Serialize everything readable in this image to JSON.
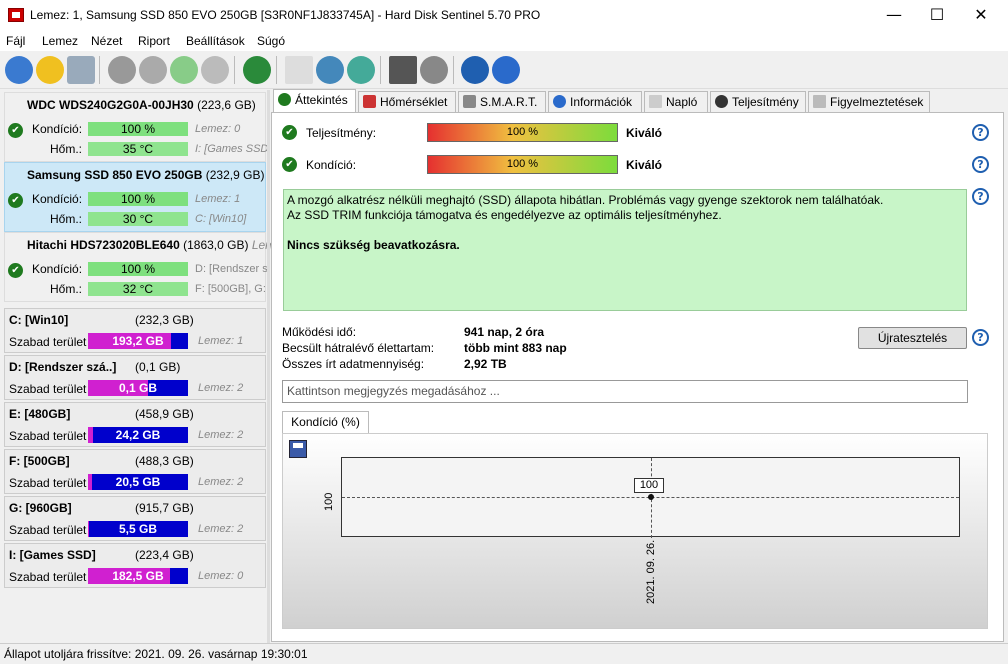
{
  "window": {
    "title": "Lemez: 1, Samsung SSD 850 EVO 250GB [S3R0NF1J833745A]  -  Hard Disk Sentinel 5.70 PRO",
    "minimize": "—",
    "maximize": "☐",
    "close": "✕"
  },
  "menu": [
    "Fájl",
    "Lemez",
    "Nézet",
    "Riport",
    "Beállítások",
    "Súgó"
  ],
  "disks": [
    {
      "name": "WDC WDS240G2G0A-00JH30",
      "size": "(223,6 GB)",
      "cond_label": "Kondíció:",
      "cond": "100 %",
      "temp_label": "Hőm.:",
      "temp": "35 °C",
      "side1": "Lemez: 0",
      "side2": "I: [Games SSD]"
    },
    {
      "name": "Samsung SSD 850 EVO 250GB",
      "size": "(232,9 GB)",
      "cond_label": "Kondíció:",
      "cond": "100 %",
      "temp_label": "Hőm.:",
      "temp": "30 °C",
      "side1": "Lemez: 1",
      "side2": "C: [Win10]"
    },
    {
      "name": "Hitachi HDS723020BLE640",
      "size": "(1863,0 GB)",
      "side0": "Lemez",
      "cond_label": "Kondíció:",
      "cond": "100 %",
      "temp_label": "Hőm.:",
      "temp": "32 °C",
      "side1": "D: [Rendszer s",
      "side2": "F: [500GB], G:"
    }
  ],
  "volumes": [
    {
      "name": "C: [Win10]",
      "size": "(232,3 GB)",
      "free_label": "Szabad terület",
      "free": "193,2 GB",
      "disk": "Lemez: 1",
      "fill": 0.83
    },
    {
      "name": "D: [Rendszer szá..]",
      "size": "(0,1 GB)",
      "free_label": "Szabad terület",
      "free": "0,1 GB",
      "disk": "Lemez: 2",
      "fill": 0.6
    },
    {
      "name": "E: [480GB]",
      "size": "(458,9 GB)",
      "free_label": "Szabad terület",
      "free": "24,2 GB",
      "disk": "Lemez: 2",
      "fill": 0.05
    },
    {
      "name": "F: [500GB]",
      "size": "(488,3 GB)",
      "free_label": "Szabad terület",
      "free": "20,5 GB",
      "disk": "Lemez: 2",
      "fill": 0.04
    },
    {
      "name": "G: [960GB]",
      "size": "(915,7 GB)",
      "free_label": "Szabad terület",
      "free": "5,5 GB",
      "disk": "Lemez: 2",
      "fill": 0.01
    },
    {
      "name": "I: [Games SSD]",
      "size": "(223,4 GB)",
      "free_label": "Szabad terület",
      "free": "182,5 GB",
      "disk": "Lemez: 0",
      "fill": 0.82
    }
  ],
  "tabs": [
    "Áttekintés",
    "Hőmérséklet",
    "S.M.A.R.T.",
    "Információk",
    "Napló",
    "Teljesítmény",
    "Figyelmeztetések"
  ],
  "overview": {
    "perf_label": "Teljesítmény:",
    "perf": "100 %",
    "perf_status": "Kiváló",
    "cond_label": "Kondíció:",
    "cond": "100 %",
    "cond_status": "Kiváló",
    "msg1": "A mozgó alkatrész nélküli meghajtó (SSD) állapota hibátlan. Problémás vagy gyenge szektorok nem találhatóak.",
    "msg2": "Az SSD TRIM funkciója támogatva és engedélyezve az optimális teljesítményhez.",
    "msg3": "Nincs szükség beavatkozásra.",
    "uptime_label": "Működési idő:",
    "uptime": "941 nap, 2 óra",
    "life_label": "Becsült hátralévő élettartam:",
    "life": "több mint 883 nap",
    "written_label": "Összes írt adatmennyiség:",
    "written": "2,92 TB",
    "restart": "Újratesztelés",
    "comment_placeholder": "Kattintson megjegyzés megadásához ...",
    "chart_tab": "Kondíció  (%)"
  },
  "chart_data": {
    "type": "line",
    "x": [
      "2021. 09. 26."
    ],
    "series": [
      {
        "values": [
          100
        ]
      }
    ],
    "point_label": "100",
    "ylabel": "100"
  },
  "status": "Állapot utoljára frissítve: 2021. 09. 26. vasárnap 19:30:01"
}
